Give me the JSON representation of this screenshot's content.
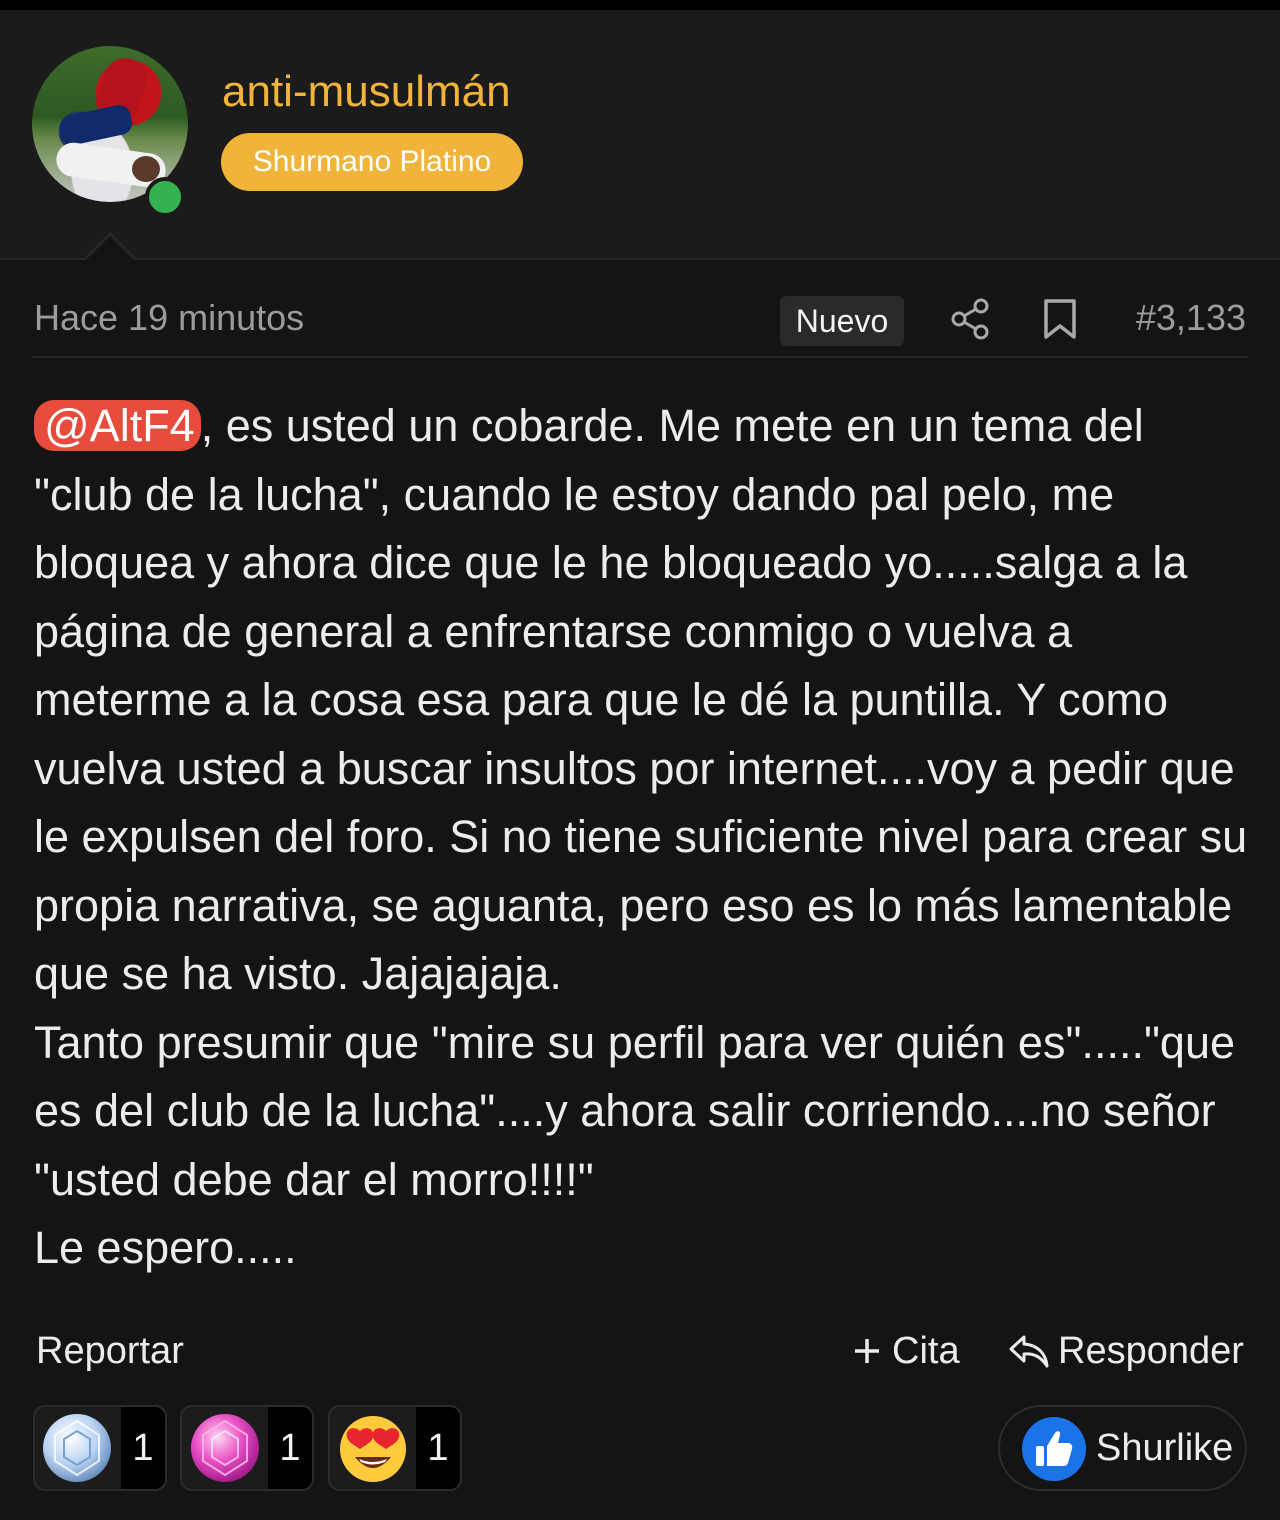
{
  "author": {
    "username": "anti-musulmán",
    "rank": "Shurmano Platino",
    "online": true
  },
  "post": {
    "time": "Hace 19 minutos",
    "new_tag": "Nuevo",
    "number": "#3,133",
    "mention": "@AltF4",
    "paragraphs": [
      ", es usted un cobarde. Me mete en un tema del \"club de la lucha\", cuando le estoy dando pal pelo, me bloquea y ahora dice que le he bloqueado yo.....salga a la página de general a enfrentarse conmigo o vuelva a meterme a la cosa esa para que le dé la puntilla. Y como vuelva usted a buscar insultos por internet....voy a pedir que le expulsen del foro. Si no tiene suficiente nivel para crear su propia narrativa, se aguanta, pero eso es lo más lamentable que se ha visto. Jajajajaja.",
      "Tanto presumir que \"mire su perfil para ver quién es\".....\"que es del club de la lucha\"....y ahora salir corriendo....no señor \"usted debe dar el morro!!!!\"",
      "Le espero....."
    ]
  },
  "actions": {
    "report": "Reportar",
    "quote": "Cita",
    "reply": "Responder"
  },
  "reactions": [
    {
      "icon": "diamond-icon",
      "count": "1"
    },
    {
      "icon": "pink-gem-icon",
      "count": "1"
    },
    {
      "icon": "heart-eyes-emoji-icon",
      "count": "1"
    }
  ],
  "like_button": {
    "label": "Shurlike",
    "icon": "thumbs-up-icon"
  },
  "colors": {
    "accent": "#f0b43a",
    "mention": "#e64b3c",
    "online": "#33b24f",
    "like": "#1b73e8",
    "background": "#141414"
  }
}
